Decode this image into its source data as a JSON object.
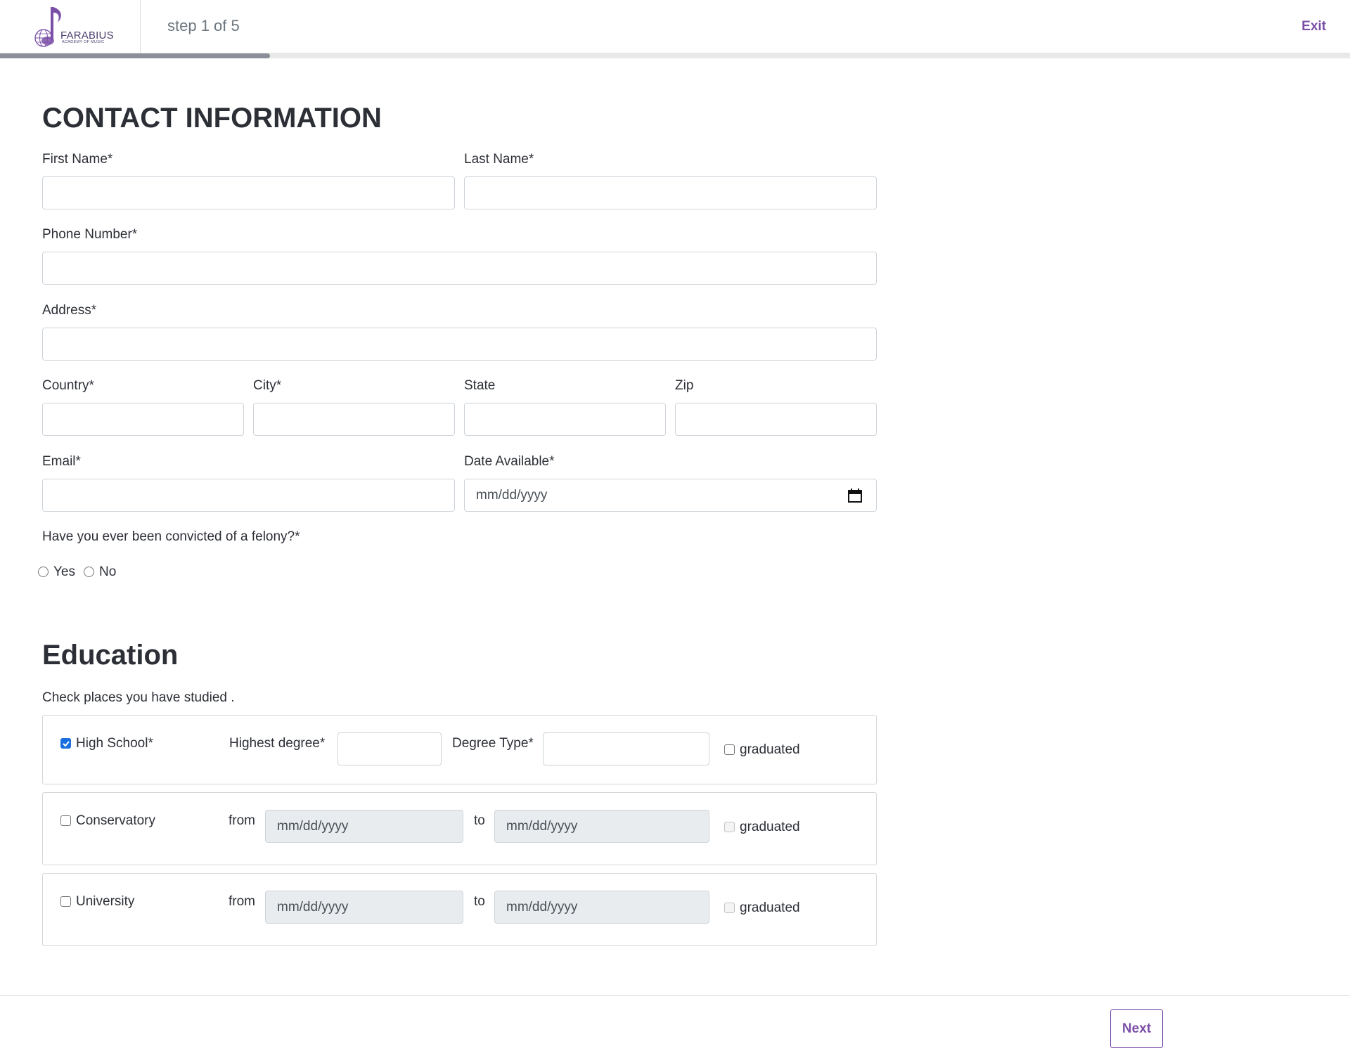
{
  "header": {
    "logo_name": "FARABIUS",
    "logo_sub": "ACADEMY OF MUSIC",
    "step_text": "step 1 of 5",
    "exit_label": "Exit",
    "progress": 0.2
  },
  "contact": {
    "title": "CONTACT INFORMATION",
    "first_name_label": "First Name*",
    "last_name_label": "Last Name*",
    "phone_label": "Phone Number*",
    "address_label": "Address*",
    "country_label": "Country*",
    "city_label": "City*",
    "state_label": "State",
    "zip_label": "Zip",
    "email_label": "Email*",
    "date_available_label": "Date Available*",
    "date_placeholder": "mm/dd/yyyy",
    "felony_question": "Have you ever been convicted of a felony?*",
    "yes_label": "Yes",
    "no_label": "No"
  },
  "education": {
    "title": "Education",
    "intro": "Check places you have studied .",
    "high_school": {
      "label": "High School*",
      "checked": true,
      "highest_degree_label": "Highest degree*",
      "degree_type_label": "Degree Type*",
      "graduated_label": "graduated"
    },
    "conservatory": {
      "label": "Conservatory",
      "checked": false,
      "from_label": "from",
      "to_label": "to",
      "from_placeholder": "mm/dd/yyyy",
      "to_placeholder": "mm/dd/yyyy",
      "graduated_label": "graduated"
    },
    "university": {
      "label": "University",
      "checked": false,
      "from_label": "from",
      "to_label": "to",
      "from_placeholder": "mm/dd/yyyy",
      "to_placeholder": "mm/dd/yyyy",
      "graduated_label": "graduated"
    }
  },
  "footer": {
    "next_label": "Next"
  },
  "colors": {
    "accent": "#7b4fa8",
    "progress": "#8a8f98",
    "checkbox_checked": "#1a6fe0"
  }
}
